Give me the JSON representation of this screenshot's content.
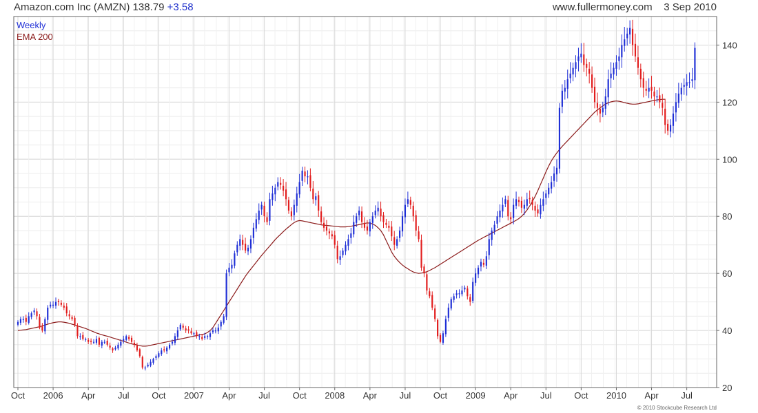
{
  "header": {
    "title": "Amazon.com Inc (AMZN)",
    "price": "138.79",
    "change": "+3.58",
    "site": "www.fullermoney.com",
    "date": "3 Sep 2010"
  },
  "legend": {
    "period": "Weekly",
    "ema": "EMA 200"
  },
  "footer": {
    "copyright": "© 2010 Stockcube Research Ltd"
  },
  "colors": {
    "up": "#1f2fd6",
    "down": "#e21d1d",
    "ema": "#8b1a1a",
    "grid": "#d8d8d8",
    "frame": "#666666"
  },
  "chart_data": {
    "type": "candlestick",
    "title": "Amazon.com Inc (AMZN) 138.79 +3.58",
    "period": "Weekly",
    "yticks": [
      20,
      40,
      60,
      80,
      100,
      120,
      140
    ],
    "ylim": [
      20,
      150
    ],
    "y_axis_side": "right",
    "grid": true,
    "legend_position": "top-left",
    "x_ticks": [
      "Oct",
      "2006",
      "Apr",
      "Jul",
      "Oct",
      "2007",
      "Apr",
      "Jul",
      "Oct",
      "2008",
      "Apr",
      "Jul",
      "Oct",
      "2009",
      "Apr",
      "Jul",
      "Oct",
      "2010",
      "Apr",
      "Jul"
    ],
    "x_tick_weeks": [
      0,
      13,
      26,
      39,
      52,
      65,
      78,
      91,
      104,
      117,
      130,
      143,
      156,
      169,
      182,
      195,
      208,
      221,
      234,
      247
    ],
    "total_weeks": 257,
    "close": [
      43,
      44,
      44,
      43,
      45,
      46,
      47,
      45,
      41,
      40,
      44,
      48,
      49,
      49,
      50,
      50,
      49,
      48,
      46,
      45,
      44,
      42,
      38,
      38,
      37,
      37,
      36,
      36,
      36,
      37,
      35,
      36,
      36,
      35,
      34,
      33,
      34,
      35,
      36,
      37,
      38,
      37,
      36,
      35,
      33,
      31,
      27,
      27,
      28,
      29,
      30,
      31,
      32,
      33,
      33,
      34,
      35,
      36,
      38,
      40,
      42,
      41,
      40,
      40,
      39,
      39,
      38,
      38,
      37,
      38,
      38,
      39,
      40,
      40,
      41,
      43,
      45,
      60,
      62,
      63,
      67,
      70,
      72,
      70,
      68,
      69,
      72,
      76,
      79,
      82,
      84,
      80,
      78,
      86,
      88,
      90,
      92,
      91,
      89,
      86,
      82,
      80,
      84,
      88,
      92,
      96,
      94,
      94,
      90,
      86,
      87,
      82,
      78,
      76,
      75,
      74,
      73,
      70,
      65,
      66,
      68,
      70,
      72,
      74,
      78,
      80,
      82,
      78,
      76,
      75,
      78,
      80,
      82,
      83,
      80,
      78,
      77,
      76,
      73,
      70,
      72,
      75,
      80,
      84,
      86,
      84,
      80,
      75,
      72,
      62,
      60,
      54,
      52,
      48,
      44,
      38,
      36,
      39,
      44,
      48,
      51,
      52,
      53,
      53,
      54,
      55,
      52,
      50,
      57,
      60,
      62,
      64,
      63,
      66,
      72,
      75,
      77,
      80,
      82,
      84,
      86,
      80,
      79,
      84,
      86,
      85,
      83,
      84,
      86,
      86,
      84,
      82,
      81,
      84,
      86,
      88,
      90,
      92,
      95,
      97,
      118,
      124,
      125,
      128,
      130,
      132,
      134,
      136,
      137,
      133,
      132,
      130,
      125,
      120,
      118,
      116,
      118,
      122,
      128,
      130,
      132,
      134,
      136,
      140,
      142,
      144,
      146,
      140,
      136,
      132,
      128,
      125,
      124,
      125,
      124,
      122,
      122,
      120,
      118,
      112,
      110,
      112,
      116,
      120,
      123,
      125,
      126,
      127,
      127,
      128,
      139
    ],
    "ema200": [
      40.0,
      40.1,
      40.2,
      40.3,
      40.5,
      40.7,
      40.9,
      41.1,
      41.3,
      41.6,
      41.9,
      42.2,
      42.5,
      42.7,
      42.9,
      43.0,
      43.0,
      42.9,
      42.7,
      42.5,
      42.2,
      41.9,
      41.6,
      41.3,
      41.0,
      40.7,
      40.3,
      39.9,
      39.5,
      39.1,
      38.8,
      38.5,
      38.2,
      38.0,
      37.7,
      37.4,
      37.1,
      36.8,
      36.5,
      36.2,
      35.9,
      35.6,
      35.3,
      35.1,
      34.9,
      34.7,
      34.5,
      34.5,
      34.6,
      34.8,
      35.0,
      35.2,
      35.4,
      35.6,
      35.8,
      36.0,
      36.2,
      36.4,
      36.6,
      36.8,
      37.0,
      37.2,
      37.4,
      37.6,
      37.8,
      38.0,
      38.2,
      38.4,
      38.6,
      38.8,
      39.3,
      40.0,
      41.0,
      42.5,
      44.0,
      45.5,
      47.0,
      48.5,
      50.0,
      51.5,
      53.0,
      54.5,
      56.0,
      57.5,
      59.0,
      60.3,
      61.5,
      62.7,
      63.9,
      65.1,
      66.3,
      67.4,
      68.5,
      69.6,
      70.7,
      71.8,
      72.8,
      73.7,
      74.6,
      75.5,
      76.3,
      77.1,
      77.8,
      78.3,
      78.5,
      78.4,
      78.2,
      78.0,
      77.8,
      77.6,
      77.4,
      77.2,
      77.0,
      76.9,
      76.8,
      76.7,
      76.6,
      76.5,
      76.4,
      76.3,
      76.3,
      76.3,
      76.4,
      76.5,
      76.7,
      76.9,
      77.1,
      77.3,
      77.5,
      77.7,
      77.6,
      77.3,
      76.8,
      76.0,
      75.0,
      73.5,
      71.5,
      69.5,
      67.5,
      66.0,
      64.8,
      63.8,
      62.9,
      62.2,
      61.6,
      61.0,
      60.5,
      60.2,
      60.0,
      60.1,
      60.3,
      60.6,
      61.0,
      61.5,
      62.0,
      62.6,
      63.2,
      63.8,
      64.4,
      65.0,
      65.6,
      66.2,
      66.8,
      67.4,
      68.0,
      68.6,
      69.2,
      69.8,
      70.4,
      71.0,
      71.6,
      72.1,
      72.6,
      73.1,
      73.6,
      74.1,
      74.6,
      75.1,
      75.6,
      76.1,
      76.6,
      77.1,
      77.6,
      78.1,
      78.6,
      79.2,
      80.0,
      81.0,
      82.2,
      83.6,
      85.2,
      87.0,
      89.0,
      91.2,
      93.4,
      95.6,
      97.6,
      99.4,
      100.9,
      102.2,
      103.4,
      104.5,
      105.5,
      106.5,
      107.5,
      108.5,
      109.5,
      110.5,
      111.5,
      112.5,
      113.5,
      114.5,
      115.5,
      116.5,
      117.3,
      118.0,
      118.7,
      119.3,
      119.8,
      120.1,
      120.3,
      120.4,
      120.3,
      120.1,
      119.8,
      119.6,
      119.4,
      119.3,
      119.3,
      119.4,
      119.6,
      119.8,
      120.0,
      120.2,
      120.4,
      120.6,
      120.8,
      120.9,
      121.0,
      121.0
    ]
  }
}
